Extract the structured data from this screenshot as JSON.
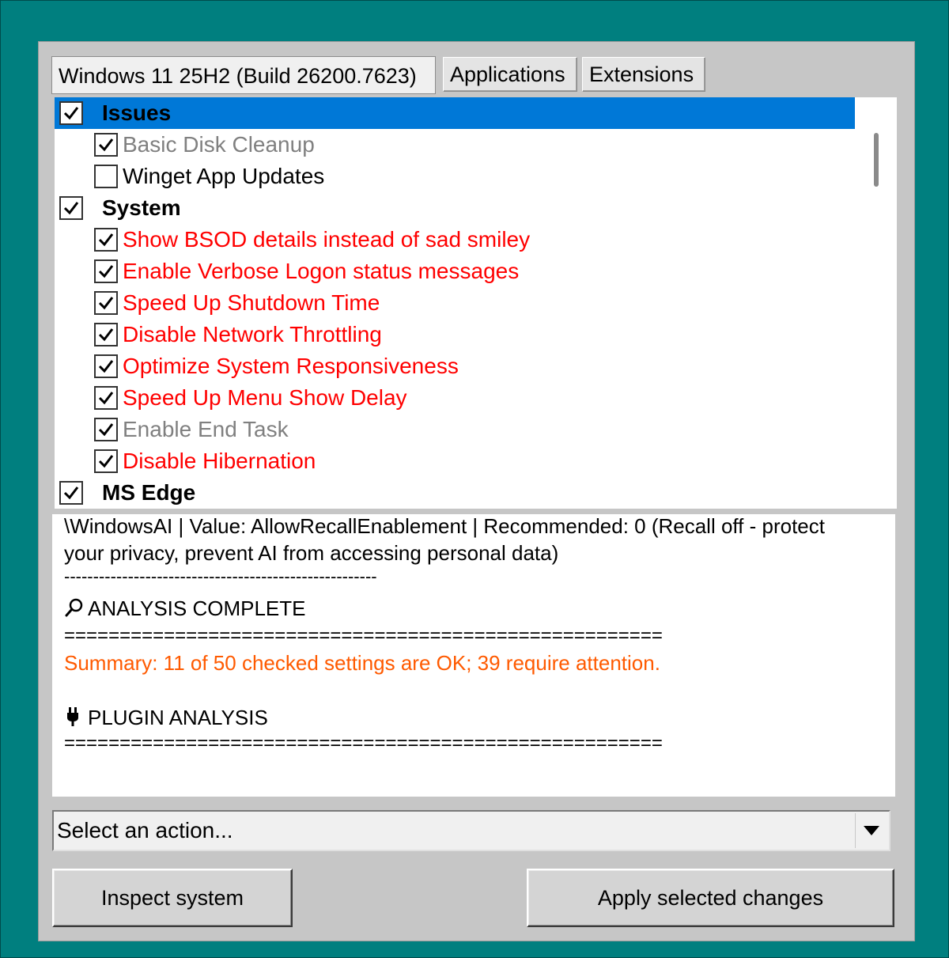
{
  "tabs": [
    {
      "label": "Windows 11 25H2 (Build 26200.7623)",
      "active": true
    },
    {
      "label": "Applications",
      "active": false
    },
    {
      "label": "Extensions",
      "active": false
    }
  ],
  "tree": {
    "rows": [
      {
        "label": "Issues",
        "kind": "group",
        "checked": true,
        "selected": true,
        "tone": "black"
      },
      {
        "label": "Basic Disk Cleanup",
        "kind": "child",
        "checked": true,
        "tone": "gray"
      },
      {
        "label": "Winget App Updates",
        "kind": "child",
        "checked": false,
        "tone": "black"
      },
      {
        "label": "System",
        "kind": "group",
        "checked": true,
        "tone": "black"
      },
      {
        "label": "Show BSOD details instead of sad smiley",
        "kind": "child",
        "checked": true,
        "tone": "red"
      },
      {
        "label": "Enable Verbose Logon status messages",
        "kind": "child",
        "checked": true,
        "tone": "red"
      },
      {
        "label": "Speed Up Shutdown Time",
        "kind": "child",
        "checked": true,
        "tone": "red"
      },
      {
        "label": "Disable Network Throttling",
        "kind": "child",
        "checked": true,
        "tone": "red"
      },
      {
        "label": "Optimize System Responsiveness",
        "kind": "child",
        "checked": true,
        "tone": "red"
      },
      {
        "label": "Speed Up Menu Show Delay",
        "kind": "child",
        "checked": true,
        "tone": "red"
      },
      {
        "label": "Enable End Task",
        "kind": "child",
        "checked": true,
        "tone": "gray"
      },
      {
        "label": "Disable Hibernation",
        "kind": "child",
        "checked": true,
        "tone": "red"
      },
      {
        "label": "MS Edge",
        "kind": "group",
        "checked": true,
        "tone": "black"
      }
    ]
  },
  "log": {
    "line1": "\\WindowsAI | Value: AllowRecallEnablement | Recommended: 0 (Recall off - protect",
    "line2": "your privacy, prevent AI from accessing personal data)",
    "separator_dash": "------------------------------------------------------",
    "analysis_icon": "🔎",
    "analysis_title": "ANALYSIS COMPLETE",
    "separator_eq1": "======================================================",
    "summary": "Summary: 11 of 50 checked settings are OK; 39 require attention.",
    "plugin_icon": "plug-icon",
    "plugin_title": "PLUGIN ANALYSIS",
    "separator_eq2": "======================================================"
  },
  "action_select": {
    "value": "Select an action..."
  },
  "buttons": {
    "inspect": "Inspect system",
    "apply": "Apply selected changes"
  },
  "colors": {
    "desktop": "#007f7f",
    "selection": "#0078d7",
    "warning_red": "#ff0000",
    "summary_orange": "#ff5a00",
    "disabled_gray": "#808080"
  }
}
